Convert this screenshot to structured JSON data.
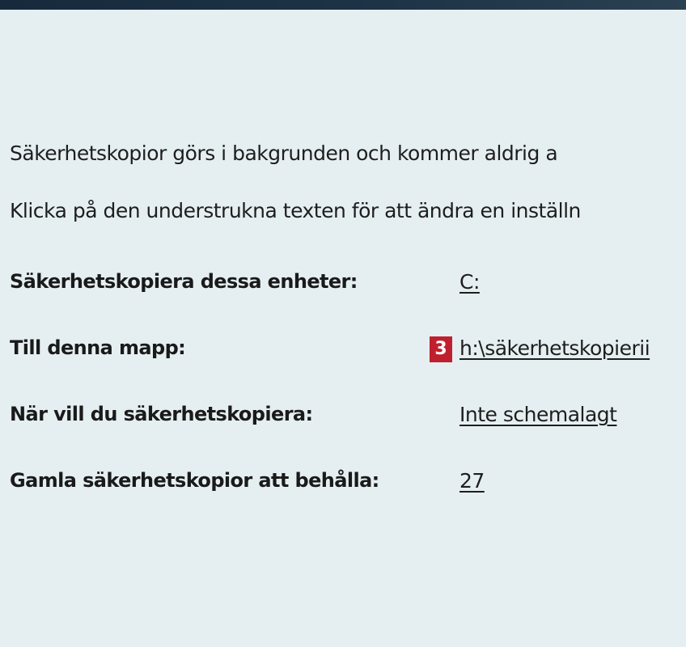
{
  "intro": {
    "line1": "Säkerhetskopior görs i bakgrunden och kommer aldrig a",
    "line2": "Klicka på den understrukna texten för att ändra en inställn"
  },
  "settings": [
    {
      "label": "Säkerhetskopiera dessa enheter:",
      "value": "C:"
    },
    {
      "label": "Till denna mapp:",
      "value": "h:\\säkerhetskopierii",
      "badge": "3"
    },
    {
      "label": "När vill du säkerhetskopiera:",
      "value": "Inte schemalagt"
    },
    {
      "label": "Gamla säkerhetskopior att behålla:",
      "value": "27"
    }
  ],
  "colors": {
    "background": "#e5eff2",
    "topbar": "#1d3346",
    "badge": "#c0202e"
  }
}
